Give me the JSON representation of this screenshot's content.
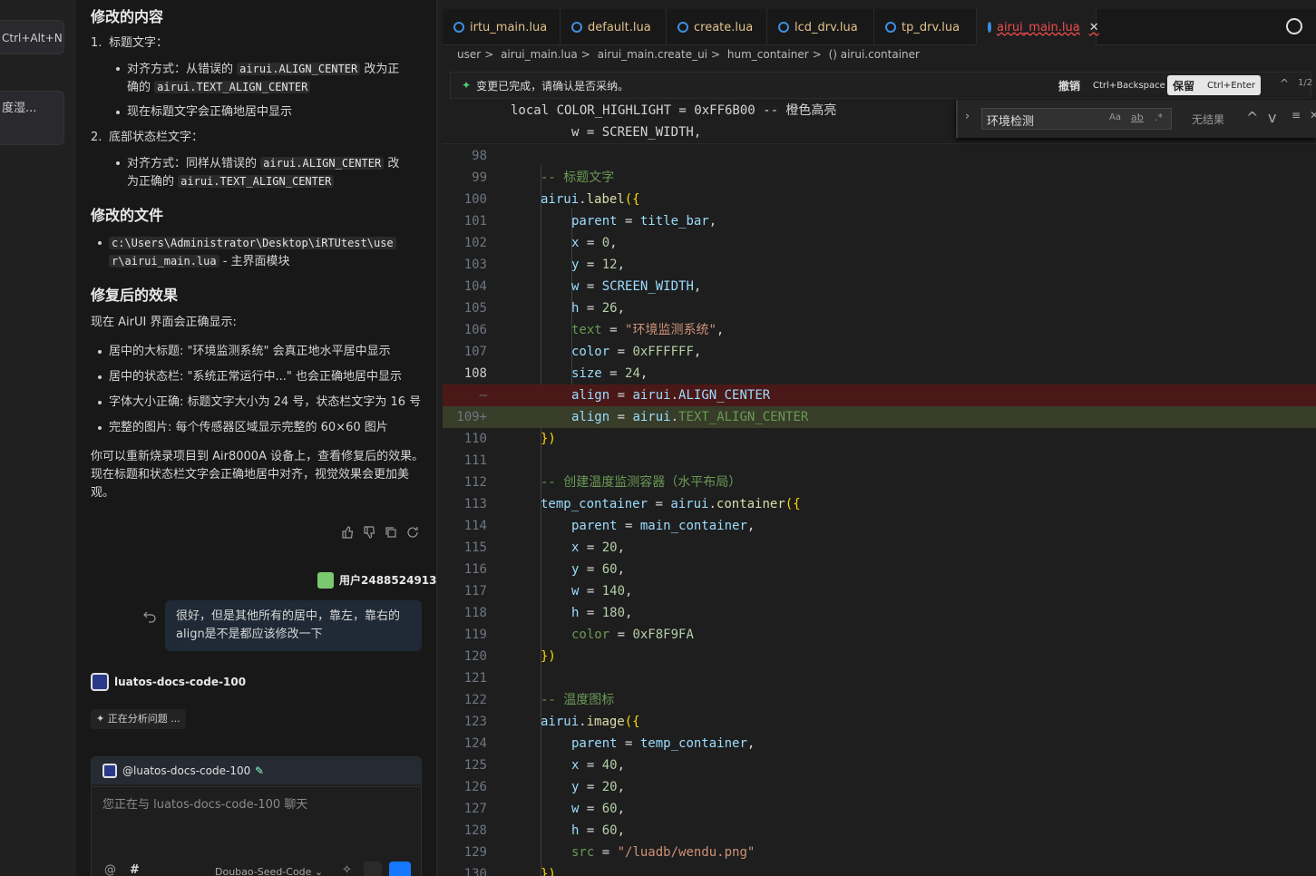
{
  "left_rail": {
    "item1": "Ctrl+Alt+N",
    "item2": "度湿..."
  },
  "chat": {
    "heading_modified": "修改的内容",
    "item1_num": "1.",
    "item1_title": "标题文字：",
    "item1_sub1_a": "对齐方式：从错误的",
    "item1_sub1_code1": "airui.ALIGN_CENTER",
    "item1_sub1_b": "改为正",
    "item1_sub1_c": "确的",
    "item1_sub1_code2": "airui.TEXT_ALIGN_CENTER",
    "item1_sub2": "现在标题文字会正确地居中显示",
    "item2_num": "2.",
    "item2_title": "底部状态栏文字：",
    "item2_sub1_a": "对齐方式：同样从错误的",
    "item2_sub1_code1": "airui.ALIGN_CENTER",
    "item2_sub1_b": "改",
    "item2_sub1_c": "为正确的",
    "item2_sub1_code2": "airui.TEXT_ALIGN_CENTER",
    "heading_files": "修改的文件",
    "file_path1": "c:\\Users\\Administrator\\Desktop\\iRTUtest\\use",
    "file_path2": "r\\airui_main.lua",
    "file_desc": "- 主界面模块",
    "heading_effect": "修复后的效果",
    "effect_intro": "现在 AirUI 界面会正确显示:",
    "effect_items": [
      "居中的大标题: \"环境监测系统\" 会真正地水平居中显示",
      "居中的状态栏: \"系统正常运行中...\" 也会正确地居中显示",
      "字体大小正确: 标题文字大小为 24 号，状态栏文字为 16 号",
      "完整的图片: 每个传感器区域显示完整的 60×60 图片"
    ],
    "closing1": "你可以重新烧录项目到 Air8000A 设备上，查看修复后的效果。",
    "closing2": "现在标题和状态栏文字会正确地居中对齐，视觉效果会更加美",
    "closing3": "观。",
    "user_name": "用户2488524913",
    "user_msg1": "很好，但是其他所有的居中，靠左，靠右的",
    "user_msg2": "align是不是都应该修改一下",
    "bot_name": "luatos-docs-code-100",
    "status": "正在分析问题 ...",
    "input_mention": "@luatos-docs-code-100",
    "input_placeholder": "您正在与 luatos-docs-code-100 聊天",
    "model": "Doubao-Seed-Code"
  },
  "editor": {
    "tabs": [
      "irtu_main.lua",
      "default.lua",
      "create.lua",
      "lcd_drv.lua",
      "tp_drv.lua",
      "airui_main.lua"
    ],
    "breadcrumbs": [
      "user",
      ">",
      "airui_main.lua",
      ">",
      "airui_main.create_ui",
      ">",
      "hum_container",
      ">",
      "() airui.container"
    ],
    "notice_text": "变更已完成，请确认是否采纳。",
    "undo_label": "撤销",
    "undo_key": "Ctrl+Backspace",
    "keep_label": "保留",
    "keep_key": "Ctrl+Enter",
    "page_indicator": "1/2",
    "find_value": "环境检测",
    "find_opt_case": "Aa",
    "find_opt_word": "ab",
    "find_opt_regex": ".*",
    "find_result": "无结果",
    "top_line1": "local COLOR_HIGHLIGHT = 0xFF6B00 -- 橙色高亮",
    "top_line2": "w = SCREEN_WIDTH,"
  }
}
